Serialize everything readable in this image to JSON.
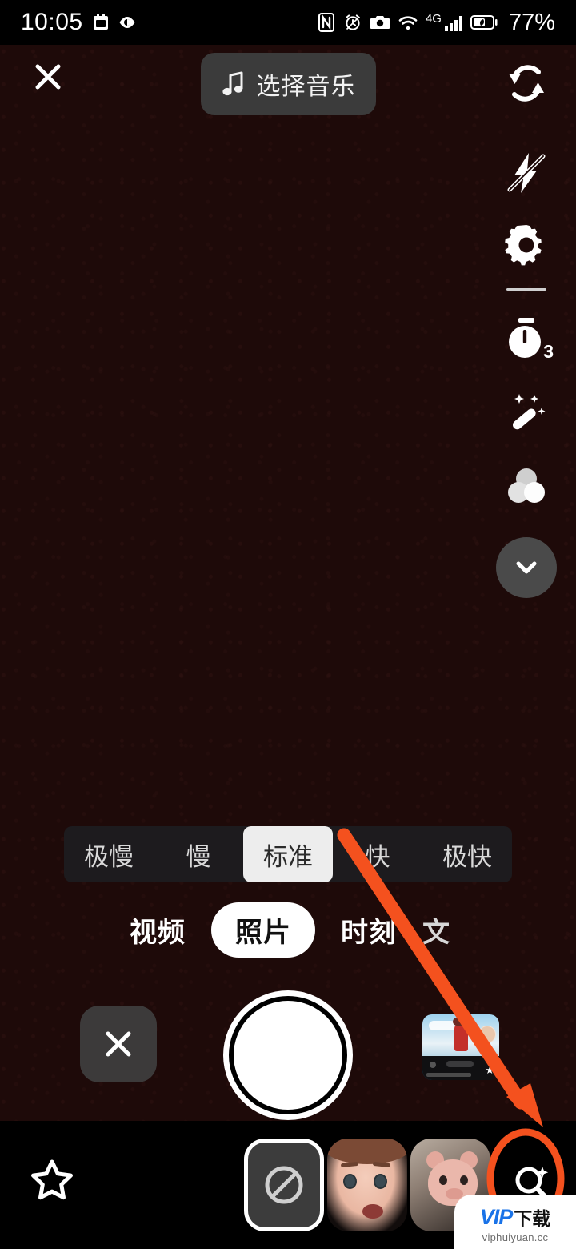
{
  "status_bar": {
    "time": "10:05",
    "battery_text": "77%",
    "network": "4G",
    "left_icons": [
      "calendar-icon",
      "eye-care-icon"
    ],
    "right_icons": [
      "nfc-icon",
      "alarm-icon",
      "camera-icon",
      "wifi-icon",
      "signal-icon",
      "battery-icon"
    ]
  },
  "top_bar": {
    "close_label": "close-icon",
    "music_label": "选择音乐",
    "music_icon": "music-note-icon",
    "flip_label": "flip-camera-icon"
  },
  "right_rail": {
    "items": [
      {
        "name": "flash-off-icon",
        "label": "闪光灯关闭"
      },
      {
        "name": "settings-gear-icon",
        "label": "设置"
      },
      {
        "name": "timer-icon",
        "label": "定时拍摄",
        "badge": "3"
      },
      {
        "name": "beauty-wand-icon",
        "label": "美颜"
      },
      {
        "name": "filters-icon",
        "label": "滤镜"
      }
    ],
    "collapse_icon": "chevron-down-icon"
  },
  "speed_bar": {
    "options": [
      "极慢",
      "慢",
      "标准",
      "快",
      "极快"
    ],
    "selected_index": 2
  },
  "modes": {
    "tabs": [
      "视频",
      "照片",
      "时刻",
      "文"
    ],
    "selected_index": 1
  },
  "capture": {
    "cancel_icon": "close-icon",
    "shutter_label": "shutter-button",
    "gallery_label": "gallery-thumbnail"
  },
  "effects_bar": {
    "favorites_icon": "star-icon",
    "items": [
      {
        "name": "effect-none",
        "icon": "no-effect-icon",
        "selected": true
      },
      {
        "name": "effect-girl-face",
        "icon": "avatar-girl-thumb",
        "selected": false
      },
      {
        "name": "effect-pig",
        "icon": "avatar-pig-thumb",
        "selected": false
      },
      {
        "name": "effect-search",
        "icon": "search-sparkle-icon",
        "selected": false
      }
    ],
    "highlighted_item": "effect-search"
  },
  "annotation": {
    "color": "#f4511e",
    "arrow": "points to search-sparkle icon",
    "ellipse": "circles search-sparkle icon"
  },
  "watermark": {
    "brand": "VIP",
    "suffix": "下载",
    "url": "viphuiyuan.cc"
  }
}
